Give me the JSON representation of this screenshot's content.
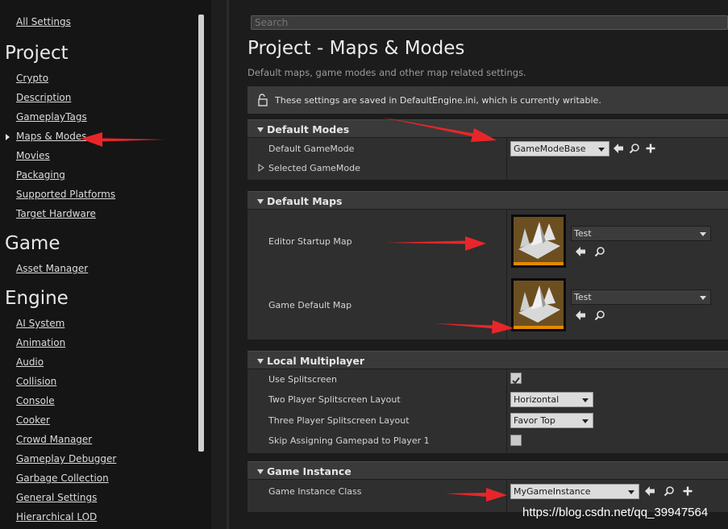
{
  "sidebar": {
    "all_settings": "All Settings",
    "project": {
      "title": "Project",
      "items": [
        "Crypto",
        "Description",
        "GameplayTags",
        "Maps & Modes",
        "Movies",
        "Packaging",
        "Supported Platforms",
        "Target Hardware"
      ]
    },
    "game": {
      "title": "Game",
      "items": [
        "Asset Manager"
      ]
    },
    "engine": {
      "title": "Engine",
      "items": [
        "AI System",
        "Animation",
        "Audio",
        "Collision",
        "Console",
        "Cooker",
        "Crowd Manager",
        "Gameplay Debugger",
        "Garbage Collection",
        "General Settings",
        "Hierarchical LOD"
      ]
    }
  },
  "search": {
    "placeholder": "Search"
  },
  "page": {
    "title": "Project - Maps & Modes",
    "subtitle": "Default maps, game modes and other map related settings.",
    "notice": "These settings are saved in DefaultEngine.ini, which is currently writable."
  },
  "default_modes": {
    "header": "Default Modes",
    "default_gamemode_label": "Default GameMode",
    "default_gamemode_value": "GameModeBase",
    "selected_gamemode_label": "Selected GameMode"
  },
  "default_maps": {
    "header": "Default Maps",
    "editor_startup_label": "Editor Startup Map",
    "editor_startup_value": "Test",
    "game_default_label": "Game Default Map",
    "game_default_value": "Test"
  },
  "local_multiplayer": {
    "header": "Local Multiplayer",
    "use_splitscreen_label": "Use Splitscreen",
    "use_splitscreen_checked": true,
    "two_player_label": "Two Player Splitscreen Layout",
    "two_player_value": "Horizontal",
    "three_player_label": "Three Player Splitscreen Layout",
    "three_player_value": "Favor Top",
    "skip_gamepad_label": "Skip Assigning Gamepad to Player 1",
    "skip_gamepad_checked": false
  },
  "game_instance": {
    "header": "Game Instance",
    "class_label": "Game Instance Class",
    "class_value": "MyGameInstance"
  },
  "watermark": "https://blog.csdn.net/qq_39947564",
  "colors": {
    "annotation_arrow": "#e8262a",
    "thumbnail_bar": "#e38a00"
  }
}
